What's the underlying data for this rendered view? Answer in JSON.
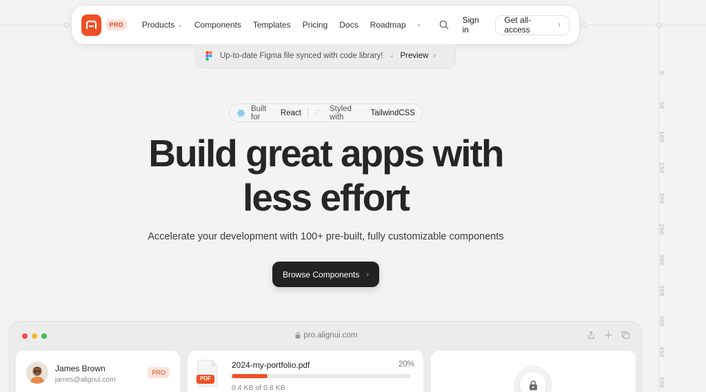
{
  "brand": {
    "pro_badge": "PRO",
    "accent": "#f04f24"
  },
  "nav": {
    "links": [
      {
        "label": "Products",
        "has_dropdown": true
      },
      {
        "label": "Components"
      },
      {
        "label": "Templates"
      },
      {
        "label": "Pricing"
      },
      {
        "label": "Docs"
      },
      {
        "label": "Roadmap"
      }
    ],
    "sign_in": "Sign in",
    "get_all_access": "Get all-access"
  },
  "banner": {
    "text": "Up-to-date Figma file synced with code library!",
    "preview": "Preview"
  },
  "tech": {
    "react_prefix": "Built for",
    "react_name": "React",
    "tailwind_prefix": "Styled with",
    "tailwind_name": "TailwindCSS"
  },
  "hero": {
    "title_line1": "Build great apps with",
    "title_line2": "less effort",
    "subtitle": "Accelerate your development with 100+ pre-built, fully customizable components",
    "cta": "Browse Components"
  },
  "ruler": {
    "ticks": [
      "0",
      "50",
      "100",
      "150",
      "200",
      "250",
      "300",
      "350",
      "400",
      "450",
      "500"
    ]
  },
  "preview_window": {
    "url": "pro.alignui.com",
    "user_card": {
      "name": "James Brown",
      "email": "james@alignui.com",
      "badge": "PRO"
    },
    "file_card": {
      "file_name": "2024-my-portfolio.pdf",
      "percent_label": "20%",
      "progress": 0.2,
      "size_label": "0.4 KB of 0.8 KB",
      "file_type": "PDF"
    }
  }
}
